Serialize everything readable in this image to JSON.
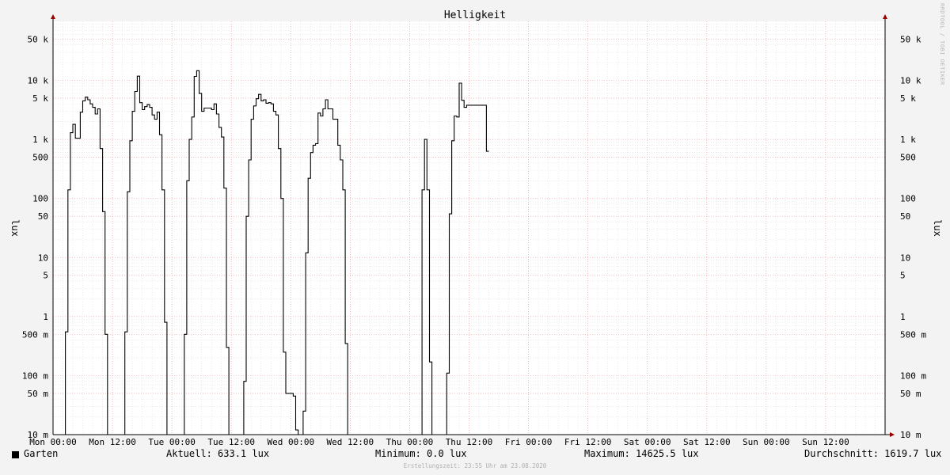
{
  "colors": {
    "background": "#f3f3f3",
    "canvas": "#ffffff",
    "grid_minor": "#dddddd",
    "grid_major": "#f2a5a5",
    "line": "#000000",
    "axis": "#000000",
    "arrow": "#990000"
  },
  "legend": {
    "series_label": "Garten",
    "current": "Aktuell: 633.1 lux",
    "minimum": "Minimum:   0.0 lux",
    "maximum": "Maximum: 14625.5 lux",
    "average": "Durchschnitt: 1619.7 lux"
  },
  "footer": "Erstellungszeit: 23:55 Uhr am 23.08.2020",
  "credit": "RRDTOOL / TOBI OETIKER",
  "chart_data": {
    "type": "line",
    "title": "Helligkeit",
    "ylabel": "lux",
    "ylabel_right": "lux",
    "yscale": "log",
    "ylim": [
      0.01,
      100000
    ],
    "xlim": [
      0,
      168
    ],
    "grid": true,
    "y_ticks": [
      {
        "value": 0.01,
        "label": "10 m"
      },
      {
        "value": 0.05,
        "label": "50 m"
      },
      {
        "value": 0.1,
        "label": "100 m"
      },
      {
        "value": 0.5,
        "label": "500 m"
      },
      {
        "value": 1,
        "label": "1"
      },
      {
        "value": 5,
        "label": "5"
      },
      {
        "value": 10,
        "label": "10"
      },
      {
        "value": 50,
        "label": "50"
      },
      {
        "value": 100,
        "label": "100"
      },
      {
        "value": 500,
        "label": "500"
      },
      {
        "value": 1000,
        "label": "1 k"
      },
      {
        "value": 5000,
        "label": "5 k"
      },
      {
        "value": 10000,
        "label": "10 k"
      },
      {
        "value": 50000,
        "label": "50 k"
      }
    ],
    "x_ticks": [
      {
        "value": 0,
        "label": "Mon 00:00"
      },
      {
        "value": 12,
        "label": "Mon 12:00"
      },
      {
        "value": 24,
        "label": "Tue 00:00"
      },
      {
        "value": 36,
        "label": "Tue 12:00"
      },
      {
        "value": 48,
        "label": "Wed 00:00"
      },
      {
        "value": 60,
        "label": "Wed 12:00"
      },
      {
        "value": 72,
        "label": "Thu 00:00"
      },
      {
        "value": 84,
        "label": "Thu 12:00"
      },
      {
        "value": 96,
        "label": "Fri 00:00"
      },
      {
        "value": 108,
        "label": "Fri 12:00"
      },
      {
        "value": 120,
        "label": "Sat 00:00"
      },
      {
        "value": 132,
        "label": "Sat 12:00"
      },
      {
        "value": 144,
        "label": "Sun 00:00"
      },
      {
        "value": 156,
        "label": "Sun 12:00"
      }
    ],
    "series": [
      {
        "name": "Garten",
        "points": [
          [
            0,
            0.01
          ],
          [
            2.5,
            0.01
          ],
          [
            2.5,
            0.55
          ],
          [
            3.0,
            0.55
          ],
          [
            3.0,
            140
          ],
          [
            3.5,
            140
          ],
          [
            3.5,
            1300
          ],
          [
            4.0,
            1300
          ],
          [
            4.0,
            1800
          ],
          [
            4.5,
            1800
          ],
          [
            4.5,
            1050
          ],
          [
            5.5,
            1050
          ],
          [
            5.5,
            2900
          ],
          [
            6.0,
            2900
          ],
          [
            6.0,
            4500
          ],
          [
            6.5,
            4500
          ],
          [
            6.5,
            5200
          ],
          [
            7.0,
            5200
          ],
          [
            7.0,
            4700
          ],
          [
            7.5,
            4700
          ],
          [
            7.5,
            4000
          ],
          [
            8.0,
            4000
          ],
          [
            8.0,
            3500
          ],
          [
            8.5,
            3500
          ],
          [
            8.5,
            2700
          ],
          [
            9.0,
            2700
          ],
          [
            9.0,
            3300
          ],
          [
            9.5,
            3300
          ],
          [
            9.5,
            700
          ],
          [
            10.0,
            700
          ],
          [
            10.0,
            60
          ],
          [
            10.5,
            60
          ],
          [
            10.5,
            0.5
          ],
          [
            11.0,
            0.5
          ],
          [
            11.0,
            0.01
          ],
          [
            14.5,
            0.01
          ],
          [
            14.5,
            0.55
          ],
          [
            15.0,
            0.55
          ],
          [
            15.0,
            130
          ],
          [
            15.5,
            130
          ],
          [
            15.5,
            950
          ],
          [
            16.0,
            950
          ],
          [
            16.0,
            3000
          ],
          [
            16.5,
            3000
          ],
          [
            16.5,
            6500
          ],
          [
            17.0,
            6500
          ],
          [
            17.0,
            11800
          ],
          [
            17.5,
            11800
          ],
          [
            17.5,
            4200
          ],
          [
            18.0,
            4200
          ],
          [
            18.0,
            3200
          ],
          [
            18.5,
            3200
          ],
          [
            18.5,
            3600
          ],
          [
            19.0,
            3600
          ],
          [
            19.0,
            3900
          ],
          [
            19.5,
            3900
          ],
          [
            19.5,
            3500
          ],
          [
            20.0,
            3500
          ],
          [
            20.0,
            2600
          ],
          [
            20.5,
            2600
          ],
          [
            20.5,
            2200
          ],
          [
            21.0,
            2200
          ],
          [
            21.0,
            2900
          ],
          [
            21.5,
            2900
          ],
          [
            21.5,
            1200
          ],
          [
            22.0,
            1200
          ],
          [
            22.0,
            140
          ],
          [
            22.5,
            140
          ],
          [
            22.5,
            0.8
          ],
          [
            23.0,
            0.8
          ],
          [
            23.0,
            0.01
          ],
          [
            26.5,
            0.01
          ],
          [
            26.5,
            0.5
          ],
          [
            27.0,
            0.5
          ],
          [
            27.0,
            200
          ],
          [
            27.5,
            200
          ],
          [
            27.5,
            1000
          ],
          [
            28.0,
            1000
          ],
          [
            28.0,
            2400
          ],
          [
            28.5,
            2400
          ],
          [
            28.5,
            11700
          ],
          [
            29.0,
            11700
          ],
          [
            29.0,
            14600
          ],
          [
            29.5,
            14600
          ],
          [
            29.5,
            6000
          ],
          [
            30.0,
            6000
          ],
          [
            30.0,
            3000
          ],
          [
            30.5,
            3000
          ],
          [
            30.5,
            3400
          ],
          [
            32.0,
            3400
          ],
          [
            32.0,
            3200
          ],
          [
            32.5,
            3200
          ],
          [
            32.5,
            4000
          ],
          [
            33.0,
            4000
          ],
          [
            33.0,
            2700
          ],
          [
            33.5,
            2700
          ],
          [
            33.5,
            1600
          ],
          [
            34.0,
            1600
          ],
          [
            34.0,
            1100
          ],
          [
            34.5,
            1100
          ],
          [
            34.5,
            150
          ],
          [
            35.0,
            150
          ],
          [
            35.0,
            0.3
          ],
          [
            35.5,
            0.3
          ],
          [
            35.5,
            0.01
          ],
          [
            38.5,
            0.01
          ],
          [
            38.5,
            0.08
          ],
          [
            39.0,
            0.08
          ],
          [
            39.0,
            50
          ],
          [
            39.5,
            50
          ],
          [
            39.5,
            450
          ],
          [
            40.0,
            450
          ],
          [
            40.0,
            2200
          ],
          [
            40.5,
            2200
          ],
          [
            40.5,
            3700
          ],
          [
            41.0,
            3700
          ],
          [
            41.0,
            4900
          ],
          [
            41.5,
            4900
          ],
          [
            41.5,
            5800
          ],
          [
            42.0,
            5800
          ],
          [
            42.0,
            4500
          ],
          [
            42.5,
            4500
          ],
          [
            42.5,
            4700
          ],
          [
            43.0,
            4700
          ],
          [
            43.0,
            4100
          ],
          [
            43.5,
            4100
          ],
          [
            43.5,
            4200
          ],
          [
            44.0,
            4200
          ],
          [
            44.0,
            4000
          ],
          [
            44.5,
            4000
          ],
          [
            44.5,
            3000
          ],
          [
            45.0,
            3000
          ],
          [
            45.0,
            2600
          ],
          [
            45.5,
            2600
          ],
          [
            45.5,
            700
          ],
          [
            46.0,
            700
          ],
          [
            46.0,
            100
          ],
          [
            46.5,
            100
          ],
          [
            46.5,
            0.25
          ],
          [
            47.0,
            0.25
          ],
          [
            47.0,
            0.05
          ],
          [
            48.5,
            0.05
          ],
          [
            48.5,
            0.045
          ],
          [
            49.0,
            0.045
          ],
          [
            49.0,
            0.012
          ],
          [
            49.5,
            0.012
          ],
          [
            49.5,
            0.01
          ],
          [
            50.5,
            0.01
          ],
          [
            50.5,
            0.025
          ],
          [
            51.0,
            0.025
          ],
          [
            51.0,
            12
          ],
          [
            51.5,
            12
          ],
          [
            51.5,
            220
          ],
          [
            52.0,
            220
          ],
          [
            52.0,
            600
          ],
          [
            52.5,
            600
          ],
          [
            52.5,
            800
          ],
          [
            53.0,
            800
          ],
          [
            53.0,
            850
          ],
          [
            53.5,
            850
          ],
          [
            53.5,
            2800
          ],
          [
            54.0,
            2800
          ],
          [
            54.0,
            2500
          ],
          [
            54.5,
            2500
          ],
          [
            54.5,
            3300
          ],
          [
            55.0,
            3300
          ],
          [
            55.0,
            4700
          ],
          [
            55.5,
            4700
          ],
          [
            55.5,
            3300
          ],
          [
            56.5,
            3300
          ],
          [
            56.5,
            2200
          ],
          [
            57.5,
            2200
          ],
          [
            57.5,
            800
          ],
          [
            58.0,
            800
          ],
          [
            58.0,
            450
          ],
          [
            58.5,
            450
          ],
          [
            58.5,
            140
          ],
          [
            59.0,
            140
          ],
          [
            59.0,
            0.35
          ],
          [
            59.5,
            0.35
          ],
          [
            59.5,
            0.01
          ],
          [
            74.5,
            0.01
          ],
          [
            74.5,
            140
          ],
          [
            75.0,
            140
          ],
          [
            75.0,
            1000
          ],
          [
            75.5,
            1000
          ],
          [
            75.5,
            140
          ],
          [
            76.0,
            140
          ],
          [
            76.0,
            0.17
          ],
          [
            76.5,
            0.17
          ],
          [
            76.5,
            0.01
          ],
          [
            79.5,
            0.01
          ],
          [
            79.5,
            0.11
          ],
          [
            80.0,
            0.11
          ],
          [
            80.0,
            55
          ],
          [
            80.5,
            55
          ],
          [
            80.5,
            950
          ],
          [
            81.0,
            950
          ],
          [
            81.0,
            2500
          ],
          [
            81.5,
            2500
          ],
          [
            81.5,
            2400
          ],
          [
            82.0,
            2400
          ],
          [
            82.0,
            9000
          ],
          [
            82.5,
            9000
          ],
          [
            82.5,
            4600
          ],
          [
            83.0,
            4600
          ],
          [
            83.0,
            3500
          ],
          [
            83.5,
            3500
          ],
          [
            83.5,
            3800
          ],
          [
            87.5,
            3800
          ],
          [
            87.5,
            630
          ],
          [
            88.0,
            630
          ]
        ]
      }
    ]
  }
}
